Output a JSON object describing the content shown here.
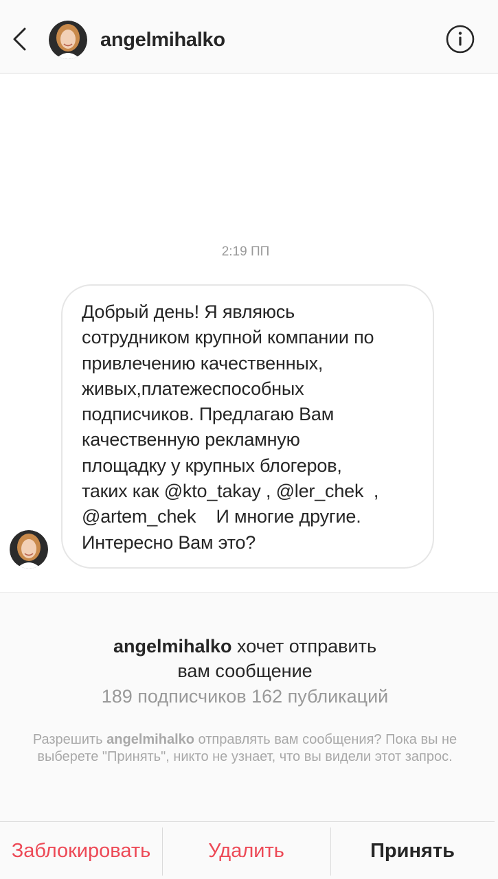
{
  "header": {
    "username": "angelmihalko",
    "back_icon": "chevron-left-icon",
    "info_icon": "info-circle-icon"
  },
  "thread": {
    "timestamp": "2:19 ПП",
    "message": {
      "lines": [
        "Добрый день! Я являюсь",
        "сотрудником крупной компании по",
        "привлечению качественных,",
        "живых,платежеспособных",
        "подписчиков. Предлагаю Вам",
        "качественную рекламную",
        "площадку у крупных блогеров,",
        "таких как @kto_takay , @ler_chek  ,",
        "@artem_chek    И многие другие.",
        "Интересно Вам это?"
      ]
    }
  },
  "request": {
    "username": "angelmihalko",
    "title_rest_line1": " хочет отправить",
    "title_line2": "вам сообщение",
    "stats": "189 подписчиков 162 публикаций",
    "note_prefix": "Разрешить ",
    "note_username": "angelmihalko",
    "note_rest": " отправлять вам сообщения? Пока вы не выберете \"Принять\", никто не узнает, что вы видели этот запрос."
  },
  "actions": {
    "block_label": "Заблокировать",
    "delete_label": "Удалить",
    "accept_label": "Принять"
  },
  "colors": {
    "destructive": "#ed4956",
    "primary_text": "#262626",
    "secondary_text": "#999999",
    "panel_bg": "#fafafa"
  }
}
